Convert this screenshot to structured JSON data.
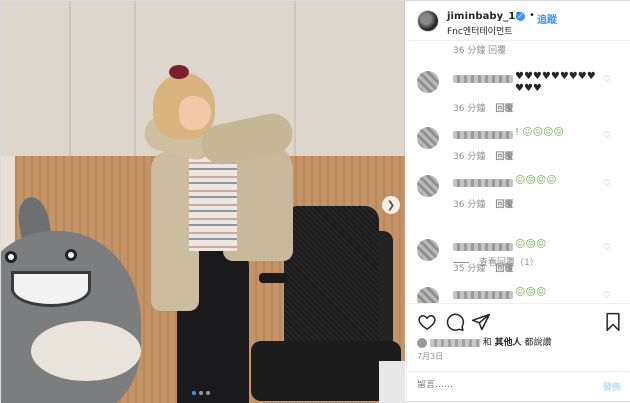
{
  "post": {
    "username": "jiminbaby_18",
    "separator": "•",
    "follow_label": "追蹤",
    "location": "Fnc엔터테이먼트"
  },
  "comments": {
    "partial_meta": "36 分鐘   回覆",
    "items": [
      {
        "text": "♥♥♥♥♥♥♥♥♥♥♥♥",
        "style": "hearts",
        "time": "36 分鐘",
        "reply": "回覆"
      },
      {
        "text": "! 😖😖😖😖",
        "style": "green",
        "time": "36 分鐘",
        "reply": "回覆"
      },
      {
        "text": "😖😖😖😖",
        "style": "green",
        "time": "36 分鐘",
        "reply": "回覆"
      },
      {
        "text": "😖😖😖",
        "style": "green",
        "time": "35 分鐘",
        "reply": "回覆"
      },
      {
        "text": "😖😖😖",
        "style": "green",
        "time": "",
        "reply": ""
      }
    ],
    "view_replies": "查看回覆（1）"
  },
  "likes": {
    "prefix": "和",
    "others": "其他人",
    "suffix": "都說讚"
  },
  "date": "7月3日",
  "add_comment": {
    "placeholder": "留言……",
    "post_label": "發佈"
  },
  "colors": {
    "accent": "#3897f0",
    "emoji_green": "#6ab04c"
  },
  "carousel": {
    "count": 3,
    "active": 1
  }
}
